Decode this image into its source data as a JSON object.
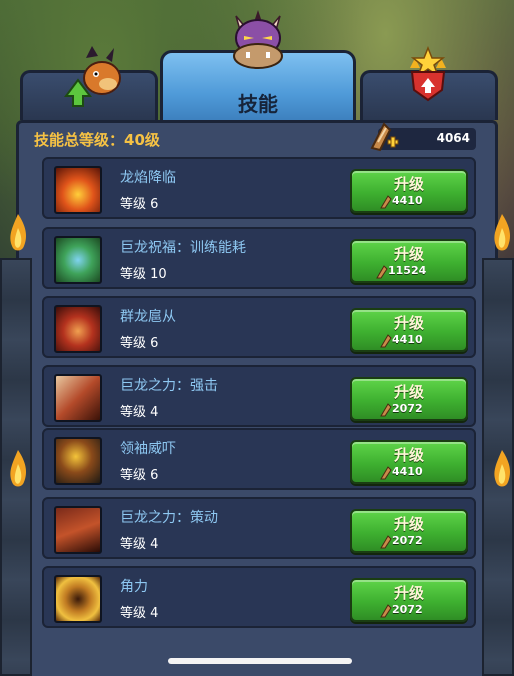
{
  "tabs": {
    "left_icon": "dragon-level-up-icon",
    "active_label": "技能",
    "active_icon": "purple-dragon-head-icon",
    "right_icon": "star-rank-up-icon"
  },
  "header": {
    "total_skill_level": "技能总等级：40级",
    "currency_value": "4064",
    "currency_icon": "claw-add-icon"
  },
  "skills": [
    {
      "name": "龙焰降临",
      "level": "等级 6",
      "button": "升级",
      "cost": "4410",
      "icon": "dragon-flame-icon"
    },
    {
      "name": "巨龙祝福：训练能耗",
      "level": "等级 10",
      "button": "升级",
      "cost": "11524",
      "icon": "dragon-blessing-icon"
    },
    {
      "name": "群龙扈从",
      "level": "等级 6",
      "button": "升级",
      "cost": "4410",
      "icon": "dragon-retinue-icon"
    },
    {
      "name": "巨龙之力：强击",
      "level": "等级 4",
      "button": "升级",
      "cost": "2072",
      "icon": "dragon-strike-icon"
    },
    {
      "name": "领袖威吓",
      "level": "等级 6",
      "button": "升级",
      "cost": "4410",
      "icon": "leader-intimidate-icon"
    },
    {
      "name": "巨龙之力：策动",
      "level": "等级 4",
      "button": "升级",
      "cost": "2072",
      "icon": "dragon-incite-icon"
    },
    {
      "name": "角力",
      "level": "等级 4",
      "button": "升级",
      "cost": "2072",
      "icon": "horn-power-icon"
    }
  ],
  "colors": {
    "accent_gold": "#f6c244",
    "skill_name": "#8ec8f2",
    "button_green": "#3eb030",
    "panel": "#3b4a69"
  }
}
